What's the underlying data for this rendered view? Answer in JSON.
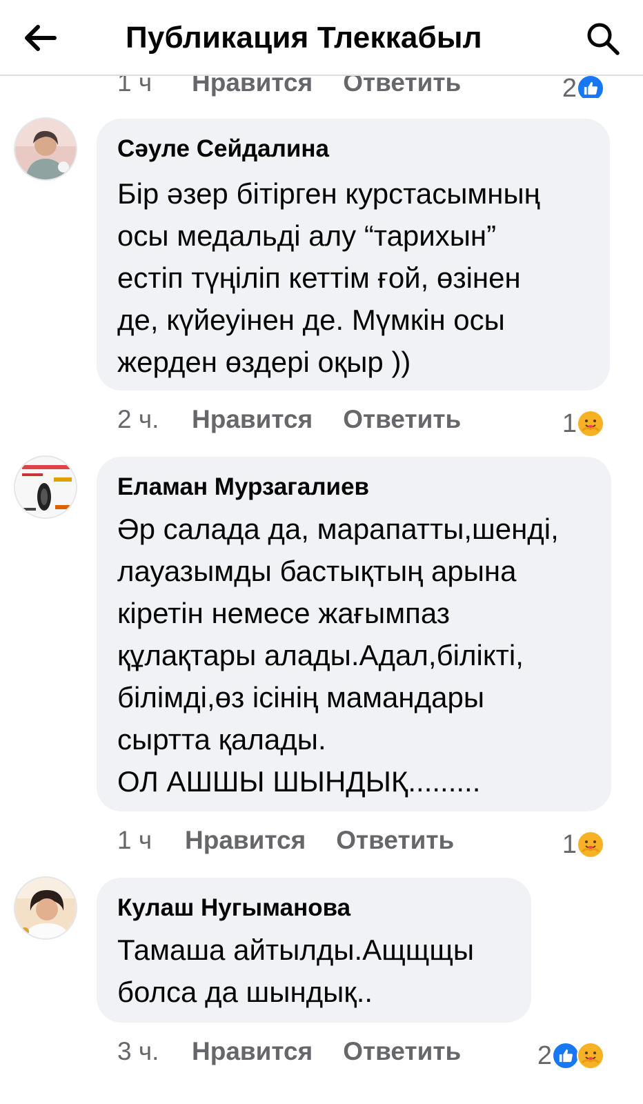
{
  "header": {
    "title": "Публикация Тлеккабыл"
  },
  "previous": {
    "time": "1 ч",
    "like_label": "Нравится",
    "reply_label": "Ответить",
    "reaction_count": "2",
    "reactions": [
      "like-icon"
    ]
  },
  "comments": [
    {
      "author": "Сәуле Сейдалина",
      "text": "Бір әзер бітірген курстасымның\nосы медальді алу “тарихын”\nестіп түңіліп кеттім ғой, өзінен\nде, күйеуінен де. Мүмкін осы\nжерден өздері оқыр ))",
      "time": "2 ч.",
      "like_label": "Нравится",
      "reply_label": "Ответить",
      "reaction_count": "1",
      "reactions": [
        "care-icon"
      ]
    },
    {
      "author": "Еламан Мурзагалиев",
      "text": "Әр салада да, марапатты,шенді,\nлауазымды бастықтың арына\nкіретін немесе жағымпаз\nқұлақтары алады.Адал,білікті,\nбілімді,өз ісінің мамандары\nсыртта қалады.\nОЛ АШШЫ ШЫНДЫҚ.........",
      "time": "1 ч",
      "like_label": "Нравится",
      "reply_label": "Ответить",
      "reaction_count": "1",
      "reactions": [
        "care-icon"
      ]
    },
    {
      "author": "Кулаш Нугыманова",
      "text": "Тамаша айтылды.Ащщщы\nболса да шындық..",
      "time": "3 ч.",
      "like_label": "Нравится",
      "reply_label": "Ответить",
      "reaction_count": "2",
      "reactions": [
        "like-icon",
        "care-icon"
      ]
    }
  ],
  "colors": {
    "bubble": "#f0f2f5",
    "meta_text": "#65676b",
    "like_blue": "#1877f2",
    "care_yellow": "#f7b125"
  }
}
